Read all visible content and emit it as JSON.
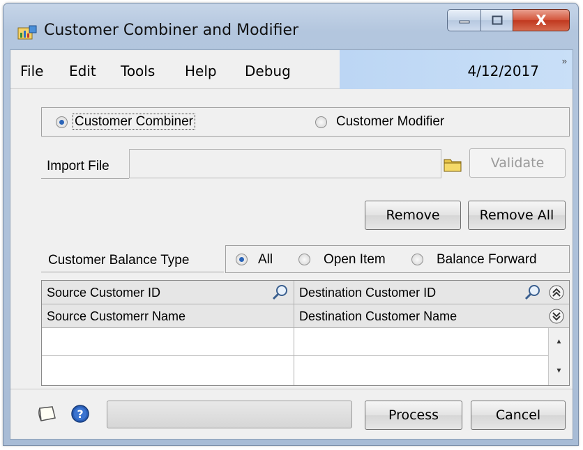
{
  "window": {
    "title": "Customer Combiner and Modifier",
    "close_glyph": "X",
    "app_icon": "application-icon"
  },
  "menu": {
    "items": [
      "File",
      "Edit",
      "Tools",
      "Help",
      "Debug"
    ],
    "date": "4/12/2017",
    "overflow_glyph": "»"
  },
  "mode": {
    "options": [
      "Customer Combiner",
      "Customer Modifier"
    ],
    "selected": "Customer Combiner"
  },
  "import": {
    "label": "Import File",
    "value": "",
    "validate_label": "Validate"
  },
  "actions": {
    "remove_label": "Remove",
    "remove_all_label": "Remove All"
  },
  "balance": {
    "label": "Customer Balance Type",
    "options": [
      "All",
      "Open Item",
      "Balance Forward"
    ],
    "selected": "All"
  },
  "grid": {
    "headers_row1": [
      "Source Customer ID",
      "Destination Customer ID"
    ],
    "headers_row2": [
      "Source Customerr Name",
      "Destination Customer Name"
    ],
    "rows": [
      [
        "",
        ""
      ],
      [
        "",
        ""
      ]
    ]
  },
  "footer": {
    "progress": 0,
    "process_label": "Process",
    "cancel_label": "Cancel"
  },
  "colors": {
    "accent": "#2a64b8",
    "datebar": "#bcd6f4",
    "close_button": "#c0381f"
  }
}
